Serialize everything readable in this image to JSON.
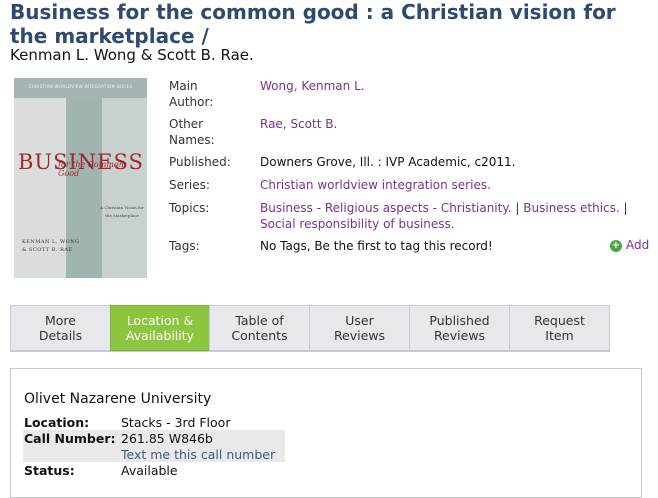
{
  "record": {
    "title": "Business for the common good : a Christian vision for the marketplace /",
    "authors": "Kenman L. Wong & Scott B. Rae."
  },
  "cover": {
    "series_text": "CHRISTIAN WORLDVIEW INTEGRATION SERIES",
    "big_title": "BUSINESS",
    "subtitle": "for the Common Good",
    "blurb": "A Christian Vision for the Marketplace",
    "authors_line1": "KENMAN L. WONG",
    "authors_line2": "& SCOTT B. RAE"
  },
  "details": {
    "main_author_label": "Main Author:",
    "main_author": "Wong, Kenman L.",
    "other_names_label": "Other Names:",
    "other_names": "Rae, Scott B.",
    "published_label": "Published:",
    "published": "Downers Grove, Ill. : IVP Academic, c2011.",
    "series_label": "Series:",
    "series": "Christian worldview integration series.",
    "topics_label": "Topics:",
    "topics": [
      "Business - Religious aspects - Christianity.",
      "Business ethics.",
      "Social responsibility of business."
    ],
    "topic_separator": "|",
    "tags_label": "Tags:",
    "tags_text": "No Tags, Be the first to tag this record!",
    "add_label": "Add",
    "add_icon": "plus-circle-icon"
  },
  "tabs": [
    {
      "label1": "More",
      "label2": "Details",
      "active": false
    },
    {
      "label1": "Location &",
      "label2": "Availability",
      "active": true
    },
    {
      "label1": "Table of",
      "label2": "Contents",
      "active": false
    },
    {
      "label1": "User",
      "label2": "Reviews",
      "active": false
    },
    {
      "label1": "Published",
      "label2": "Reviews",
      "active": false
    },
    {
      "label1": "Request",
      "label2": "Item",
      "active": false
    }
  ],
  "holdings": {
    "library": "Olivet Nazarene University",
    "location_label": "Location:",
    "location": "Stacks - 3rd Floor",
    "call_number_label": "Call Number:",
    "call_number": "261.85 W846b",
    "text_link": "Text me this call number",
    "status_label": "Status:",
    "status": "Available"
  },
  "colors": {
    "title": "#2e4a6e",
    "link": "#76348a",
    "active_tab": "#8dc53e"
  }
}
